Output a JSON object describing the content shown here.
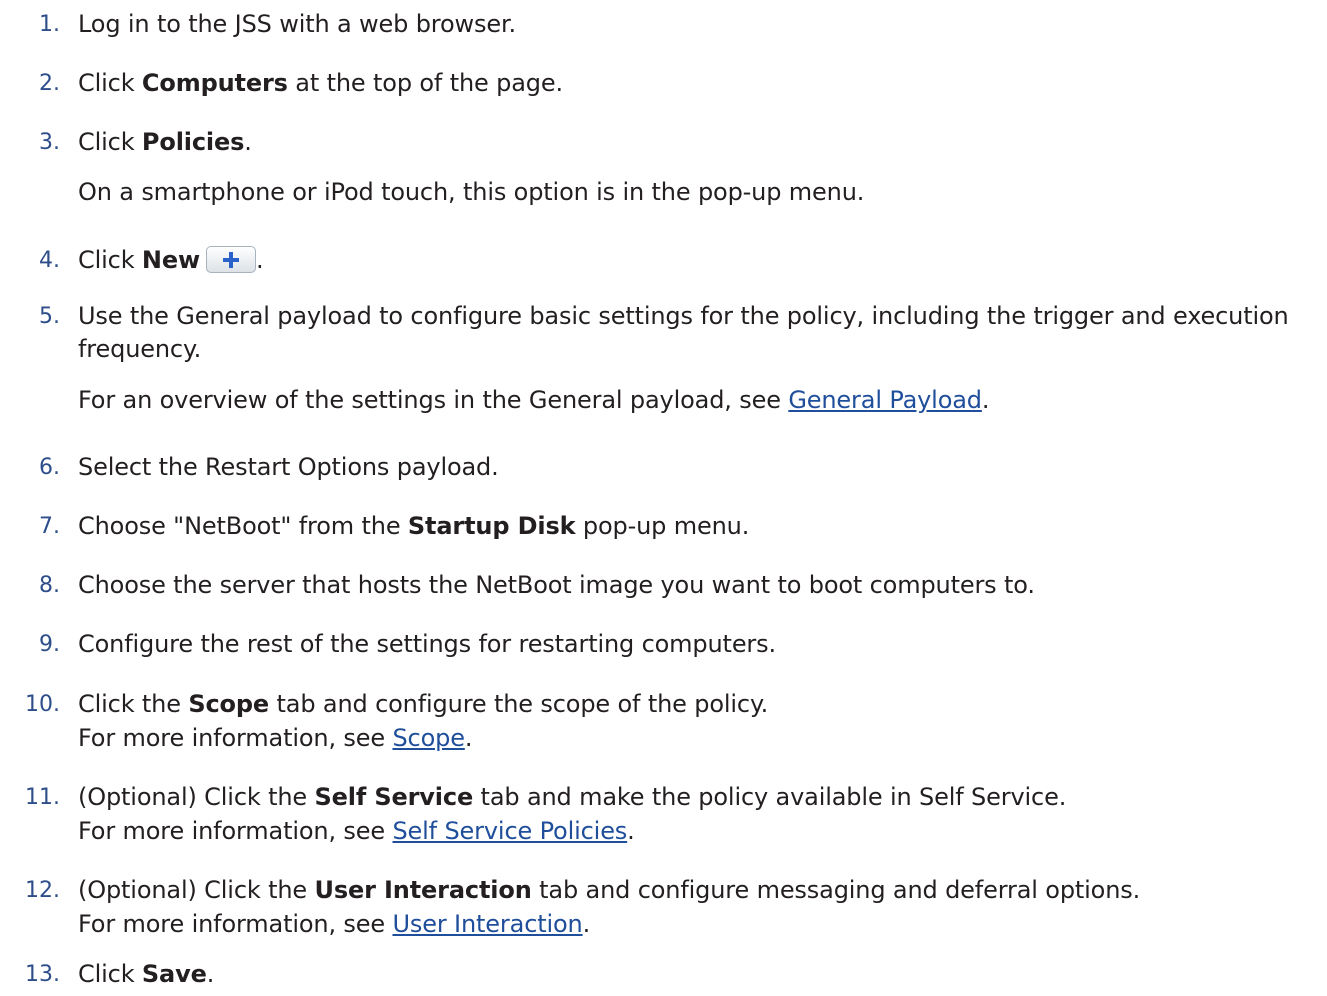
{
  "steps": [
    {
      "n": "1.",
      "t": "Log in to the JSS with a web browser."
    },
    {
      "n": "2.",
      "pre": "Click ",
      "b": "Computers",
      "post": " at the top of the page."
    },
    {
      "n": "3.",
      "pre": "Click ",
      "b": "Policies",
      "post": ".",
      "note": "On a smartphone or iPod touch, this option is in the pop-up menu."
    },
    {
      "n": "4.",
      "pre": "Click ",
      "b": "New",
      "post": "."
    },
    {
      "n": "5.",
      "t1": "Use the General payload to configure basic settings for the policy, including the trigger and execution",
      "t2": "frequency.",
      "note_pre": "For an overview of the settings in the General payload, see ",
      "link": "General Payload",
      "note_post": "."
    },
    {
      "n": "6.",
      "t": "Select the Restart Options payload."
    },
    {
      "n": "7.",
      "pre": "Choose \"NetBoot\" from the ",
      "b": "Startup Disk",
      "post": " pop-up menu."
    },
    {
      "n": "8.",
      "t": "Choose the server that hosts the NetBoot image you want to boot computers to."
    },
    {
      "n": "9.",
      "t": "Configure the rest of the settings for restarting computers."
    },
    {
      "n": "10.",
      "pre": "Click the ",
      "b": "Scope",
      "post": " tab and configure the scope of the policy.",
      "note_pre": "For more information, see ",
      "link": "Scope",
      "note_post": "."
    },
    {
      "n": "11.",
      "pre": "(Optional) Click the ",
      "b": "Self Service",
      "post": " tab and make the policy available in Self Service.",
      "note_pre": "For more information, see ",
      "link": "Self Service Policies",
      "note_post": "."
    },
    {
      "n": "12.",
      "pre": "(Optional) Click the ",
      "b": "User Interaction",
      "post": " tab and configure messaging and deferral options.",
      "note_pre": "For more information, see ",
      "link": "User Interaction",
      "note_post": "."
    },
    {
      "n": "13.",
      "pre": "Click ",
      "b": "Save",
      "post": "."
    }
  ],
  "colors": {
    "number": "#2e4e8a",
    "link": "#1f4e9b",
    "plus_icon": "#2a62c9"
  }
}
